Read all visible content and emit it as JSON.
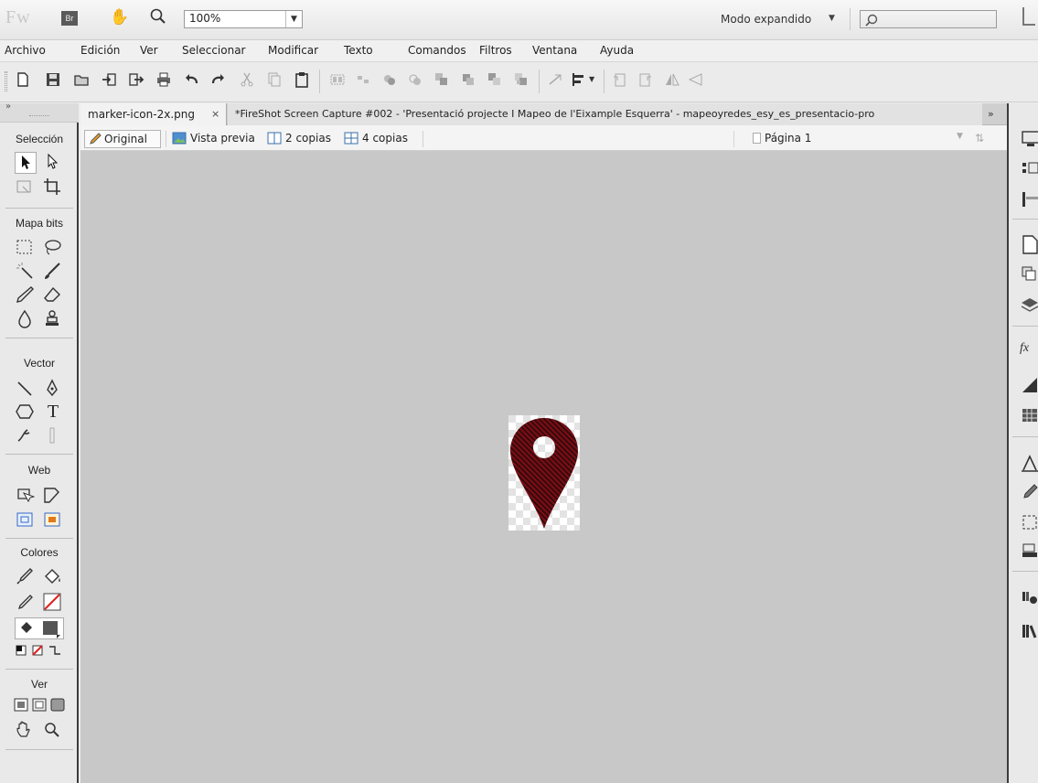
{
  "appbar": {
    "logo_text": "Fw",
    "bridge_label": "Br",
    "zoom_value": "100%",
    "mode_label": "Modo expandido"
  },
  "menu": {
    "items": [
      "Archivo",
      "Edición",
      "Ver",
      "Seleccionar",
      "Modificar",
      "Texto",
      "Comandos",
      "Filtros",
      "Ventana",
      "Ayuda"
    ]
  },
  "tools": {
    "sections": [
      "Selección",
      "Mapa bits",
      "Vector",
      "Web",
      "Colores",
      "Ver"
    ]
  },
  "tabs": {
    "items": [
      {
        "label": "marker-icon-2x.png"
      },
      {
        "label": "*FireShot Screen Capture #002 - 'Presentació projecte I Mapeo de l'Eixample Esquerra' - mapeoyredes_esy_es_presentacio-pro"
      }
    ],
    "overflow": "»"
  },
  "view": {
    "original": "Original",
    "preview": "Vista previa",
    "two_up": "2 copias",
    "four_up": "4 copias",
    "page": "Página 1"
  },
  "colors": {
    "marker": "#7a0d14",
    "stroke_color": "#e02020",
    "dark_panel_border": "#3b3b3b"
  }
}
